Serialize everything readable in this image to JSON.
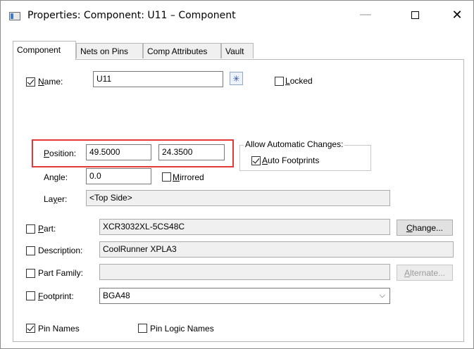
{
  "window": {
    "title": "Properties: Component: U11 – Component",
    "minimize_glyph": "—",
    "close_glyph": "✕"
  },
  "tabs": [
    {
      "label": "Component",
      "active": true
    },
    {
      "label": "Nets on Pins",
      "active": false
    },
    {
      "label": "Comp Attributes",
      "active": false
    },
    {
      "label": "Vault",
      "active": false
    }
  ],
  "name": {
    "label": "Name:",
    "label_underline": "N",
    "label_rest": "ame:",
    "value": "U11",
    "checked": true
  },
  "locked": {
    "label_underline": "L",
    "label_rest": "ocked",
    "checked": false
  },
  "position": {
    "label_underline": "P",
    "label_rest": "osition:",
    "x": "49.5000",
    "y": "24.3500"
  },
  "auto_changes": {
    "group_title": "Allow Automatic Changes:",
    "auto_footprints_underline": "A",
    "auto_footprints_rest": "uto Footprints",
    "checked": true
  },
  "angle": {
    "label": "Angle:",
    "value": "0.0"
  },
  "mirrored": {
    "label_underline": "M",
    "label_rest": "irrored",
    "checked": false
  },
  "layer": {
    "label_pre": "La",
    "label_underline": "y",
    "label_post": "er:",
    "value": "<Top Side>"
  },
  "part": {
    "label_underline": "P",
    "label_rest": "art:",
    "value": "XCR3032XL-5CS48C",
    "checked": false,
    "button_underline": "C",
    "button_rest": "hange..."
  },
  "description": {
    "label": "Description:",
    "value": "CoolRunner XPLA3",
    "checked": false
  },
  "part_family": {
    "label": "Part Family:",
    "value": "",
    "checked": false,
    "button_underline": "A",
    "button_rest": "lternate..."
  },
  "footprint": {
    "label_underline": "F",
    "label_rest": "ootprint:",
    "value": "BGA48",
    "checked": false
  },
  "pin_names": {
    "label": "Pin Names",
    "checked": true
  },
  "pin_logic_names": {
    "label": "Pin Logic Names",
    "checked": false
  },
  "colors": {
    "highlight": "#e53935",
    "accent": "#3a7bd5"
  },
  "icons": {
    "refresh": "snowflake-refresh-icon",
    "dropdown": "chevron-down-icon"
  }
}
